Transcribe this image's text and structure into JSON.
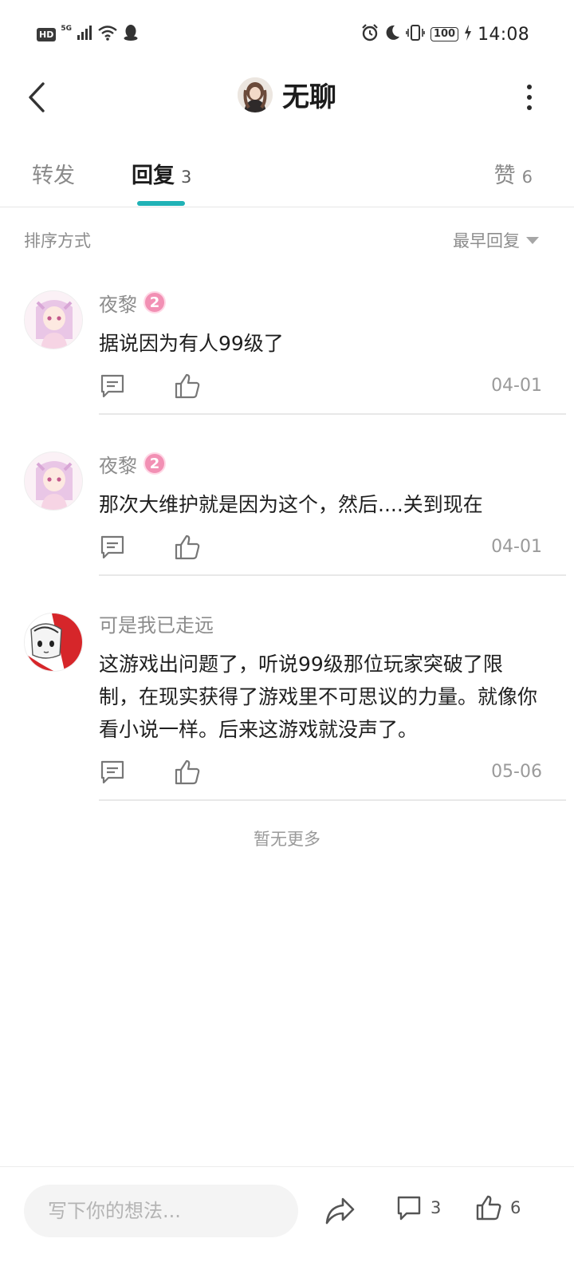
{
  "status_bar": {
    "hd": "HD",
    "network": "5G",
    "battery": "100",
    "time": "14:08"
  },
  "header": {
    "title": "无聊"
  },
  "tabs": [
    {
      "label": "转发",
      "count": ""
    },
    {
      "label": "回复",
      "count": "3"
    },
    {
      "label": "赞",
      "count": "6"
    }
  ],
  "sort": {
    "label": "排序方式",
    "selected": "最早回复"
  },
  "comments": [
    {
      "name": "夜黎",
      "level": "2",
      "text": "据说因为有人99级了",
      "date": "04-01"
    },
    {
      "name": "夜黎",
      "level": "2",
      "text": "那次大维护就是因为这个，然后....关到现在",
      "date": "04-01"
    },
    {
      "name": "可是我已走远",
      "level": "",
      "text": "这游戏出问题了，听说99级那位玩家突破了限制，在现实获得了游戏里不可思议的力量。就像你看小说一样。后来这游戏就没声了。",
      "date": "05-06"
    }
  ],
  "footer_note": "暂无更多",
  "bottom_bar": {
    "placeholder": "写下你的想法...",
    "comment_count": "3",
    "like_count": "6"
  },
  "colors": {
    "accent": "#20b2b6",
    "level_badge": "#f290b4"
  }
}
